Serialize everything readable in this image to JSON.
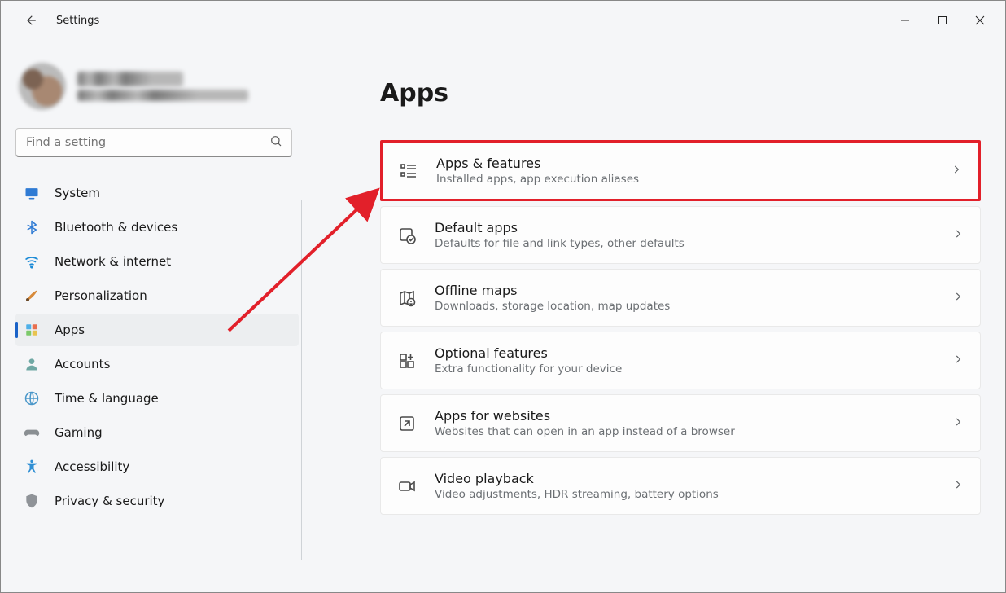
{
  "window": {
    "title": "Settings"
  },
  "search": {
    "placeholder": "Find a setting"
  },
  "sidebar": {
    "items": [
      {
        "id": "system",
        "label": "System"
      },
      {
        "id": "bluetooth",
        "label": "Bluetooth & devices"
      },
      {
        "id": "network",
        "label": "Network & internet"
      },
      {
        "id": "personalization",
        "label": "Personalization"
      },
      {
        "id": "apps",
        "label": "Apps"
      },
      {
        "id": "accounts",
        "label": "Accounts"
      },
      {
        "id": "time-language",
        "label": "Time & language"
      },
      {
        "id": "gaming",
        "label": "Gaming"
      },
      {
        "id": "accessibility",
        "label": "Accessibility"
      },
      {
        "id": "privacy",
        "label": "Privacy & security"
      }
    ],
    "active_index": 4
  },
  "page": {
    "title": "Apps",
    "cards": [
      {
        "id": "apps-features",
        "title": "Apps & features",
        "subtitle": "Installed apps, app execution aliases"
      },
      {
        "id": "default-apps",
        "title": "Default apps",
        "subtitle": "Defaults for file and link types, other defaults"
      },
      {
        "id": "offline-maps",
        "title": "Offline maps",
        "subtitle": "Downloads, storage location, map updates"
      },
      {
        "id": "optional-features",
        "title": "Optional features",
        "subtitle": "Extra functionality for your device"
      },
      {
        "id": "apps-for-websites",
        "title": "Apps for websites",
        "subtitle": "Websites that can open in an app instead of a browser"
      },
      {
        "id": "video-playback",
        "title": "Video playback",
        "subtitle": "Video adjustments, HDR streaming, battery options"
      }
    ],
    "highlight_index": 0
  },
  "annotation": {
    "highlight_color": "#e2202a",
    "arrow_target": "apps-features"
  }
}
